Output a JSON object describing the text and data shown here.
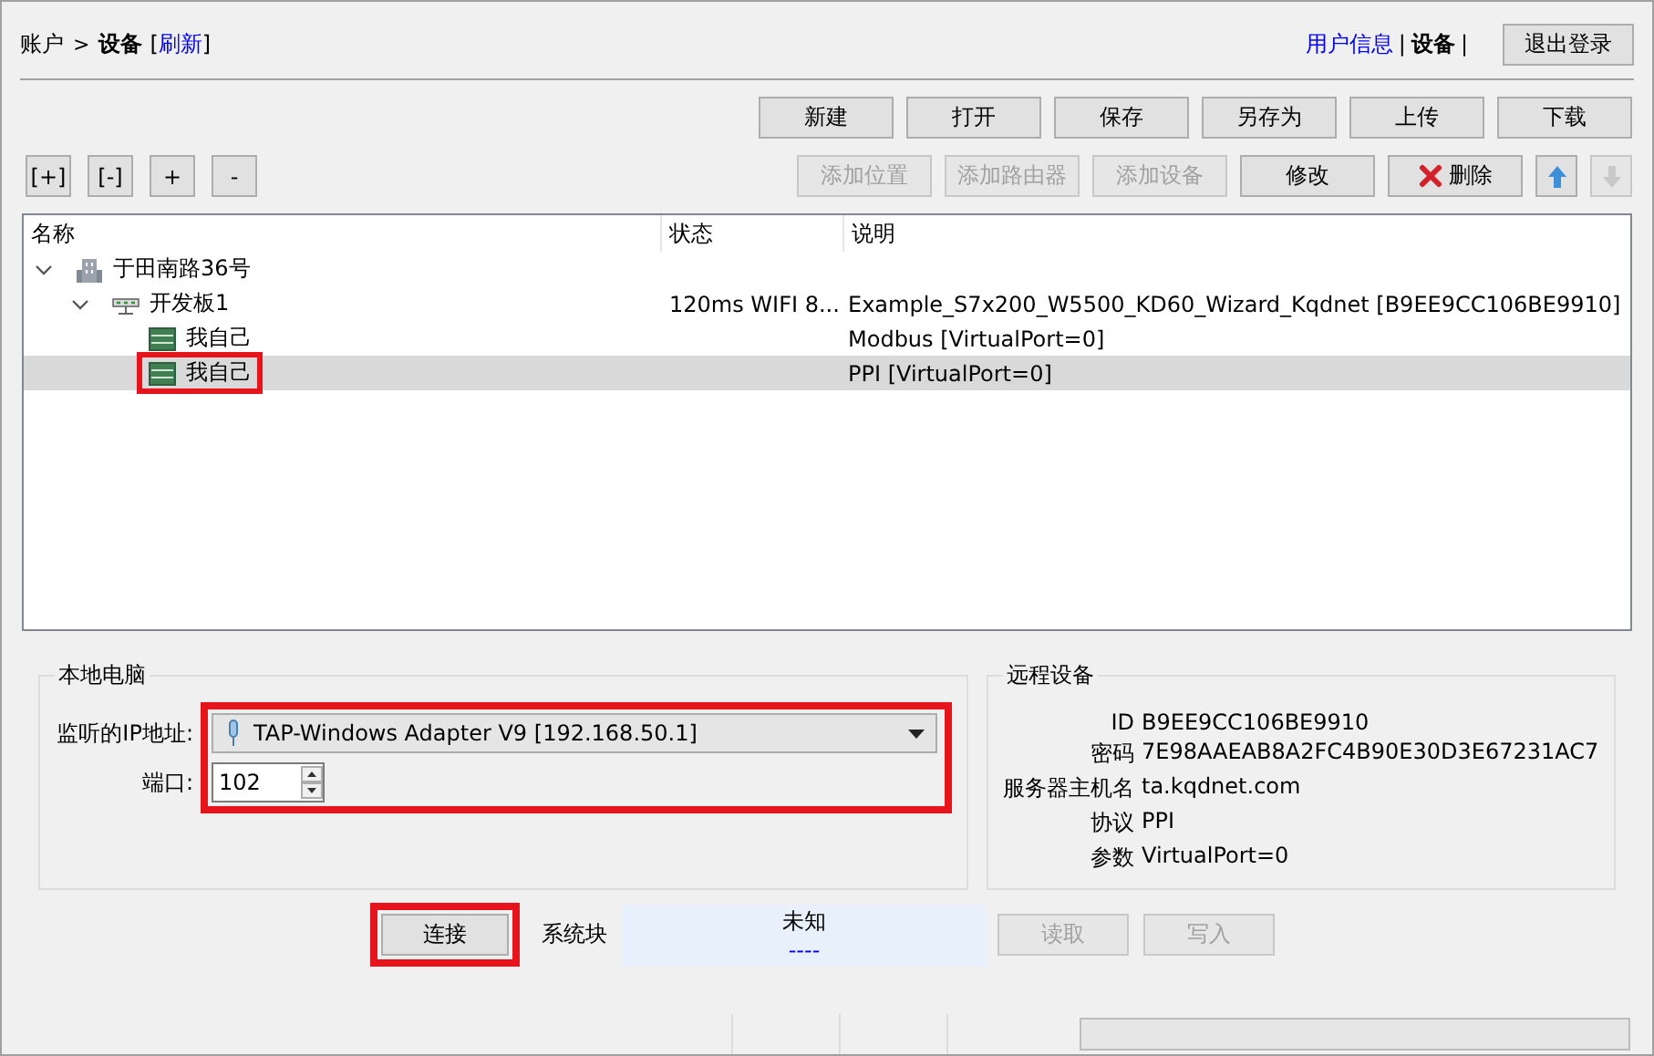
{
  "breadcrumb": {
    "root": "账户",
    "separator": ">",
    "current": "设备",
    "bracket_open": "[",
    "refresh": "刷新",
    "bracket_close": "]"
  },
  "nav": [
    {
      "label": "用户信息",
      "kind": "link"
    },
    {
      "label": "|",
      "kind": "separator"
    },
    {
      "label": "设备",
      "kind": "current"
    },
    {
      "label": "|",
      "kind": "separator"
    }
  ],
  "logout": "退出登录",
  "file_buttons": [
    {
      "label": "新建",
      "disabled": false
    },
    {
      "label": "打开",
      "disabled": false
    },
    {
      "label": "保存",
      "disabled": false
    },
    {
      "label": "另存为",
      "disabled": false
    },
    {
      "label": "上传",
      "disabled": false
    },
    {
      "label": "下载",
      "disabled": false
    }
  ],
  "tree_buttons": [
    "[+]",
    "[-]",
    "+",
    "-"
  ],
  "edit_buttons": [
    {
      "kind": "text",
      "label": "添加位置",
      "disabled": true
    },
    {
      "kind": "text",
      "label": "添加路由器",
      "disabled": true
    },
    {
      "kind": "text",
      "label": "添加设备",
      "disabled": true
    },
    {
      "kind": "text",
      "label": "修改",
      "disabled": false
    },
    {
      "kind": "delete",
      "label": "删除",
      "disabled": false
    },
    {
      "kind": "up",
      "disabled": false
    },
    {
      "kind": "down",
      "disabled": true
    }
  ],
  "tree": {
    "columns": [
      "名称",
      "状态",
      "说明"
    ],
    "rows": [
      {
        "kind": "site",
        "name": "于田南路36号",
        "expanded": true,
        "selected": false,
        "highlighted": false,
        "children": [
          {
            "kind": "router",
            "name": "开发板1",
            "status": "120ms WIFI 8...",
            "description": "Example_S7x200_W5500_KD60_Wizard_Kqdnet [B9EE9CC106BE9910]",
            "expanded": true,
            "selected": false,
            "highlighted": false,
            "children": [
              {
                "kind": "device",
                "name": "我自己",
                "description": "Modbus [VirtualPort=0]",
                "selected": false,
                "highlighted": false
              },
              {
                "kind": "device",
                "name": "我自己",
                "description": "PPI [VirtualPort=0]",
                "selected": true,
                "highlighted": true
              }
            ]
          }
        ]
      }
    ]
  },
  "local": {
    "title": "本地电脑",
    "ip_label": "监听的IP地址:",
    "ip_value": "TAP-Windows Adapter V9 [192.168.50.1]",
    "port_label": "端口:",
    "port_value": "102",
    "highlighted": true
  },
  "remote": {
    "title": "远程设备",
    "fields": [
      {
        "label": "ID",
        "value": "B9EE9CC106BE9910"
      },
      {
        "label": "密码",
        "value": "7E98AAEAB8A2FC4B90E30D3E67231AC7"
      },
      {
        "label": "服务器主机名",
        "value": "ta.kqdnet.com"
      },
      {
        "label": "协议",
        "value": "PPI"
      },
      {
        "label": "参数",
        "value": "VirtualPort=0"
      }
    ]
  },
  "connect": {
    "label": "连接",
    "highlighted": true
  },
  "system_block": {
    "label": "系统块",
    "status": "未知",
    "detail": "----"
  },
  "io_buttons": [
    {
      "label": "读取",
      "disabled": true
    },
    {
      "label": "写入",
      "disabled": true
    }
  ],
  "status_bar": {
    "progress": {
      "level": 0
    }
  }
}
